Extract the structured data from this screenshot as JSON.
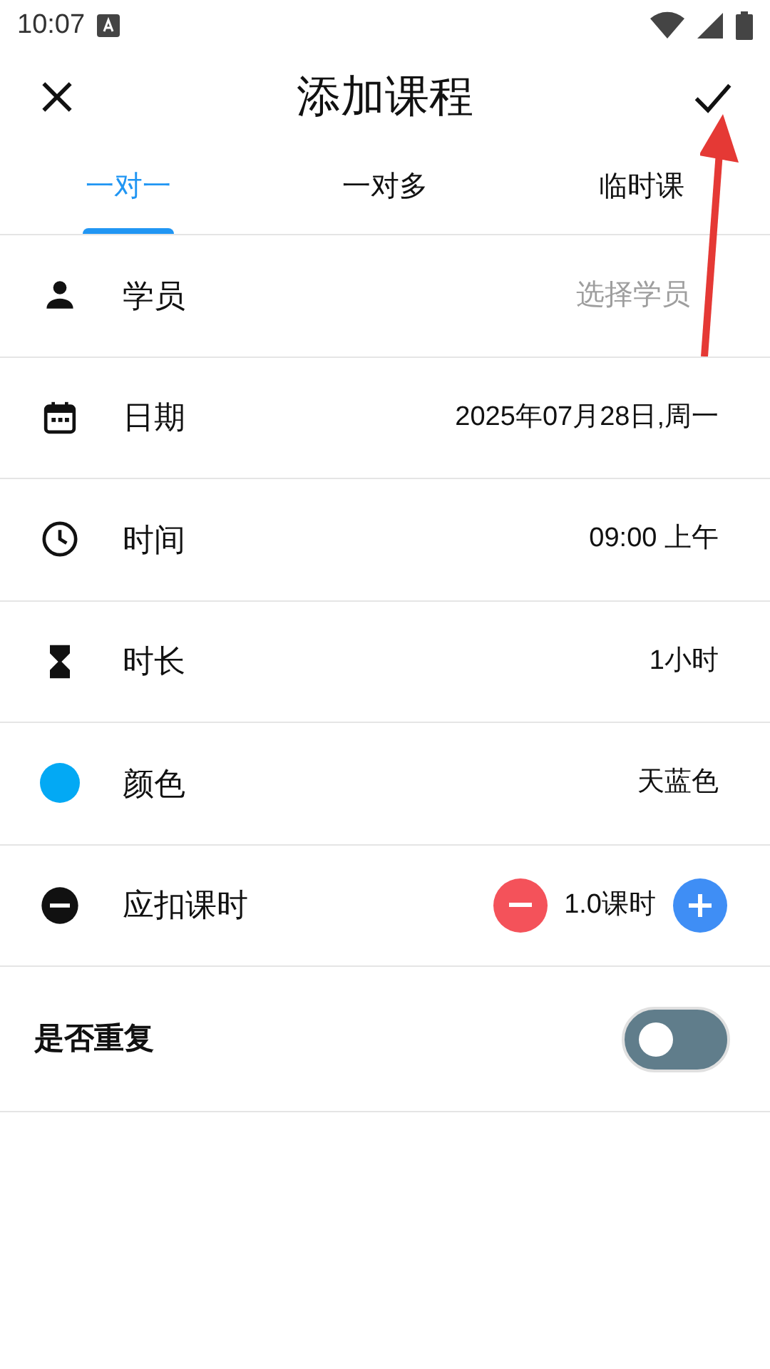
{
  "status_bar": {
    "time": "10:07"
  },
  "header": {
    "title": "添加课程"
  },
  "tabs": [
    {
      "label": "一对一",
      "selected": true
    },
    {
      "label": "一对多",
      "selected": false
    },
    {
      "label": "临时课",
      "selected": false
    }
  ],
  "rows": [
    {
      "kind": "field",
      "label": "学员",
      "placeholder": "选择学员"
    },
    {
      "kind": "field",
      "label": "日期",
      "value": "2025年07月28日,周一"
    },
    {
      "kind": "field",
      "label": "时间",
      "value": "09:00 上午"
    },
    {
      "kind": "field",
      "label": "时长",
      "value": "1小时"
    },
    {
      "kind": "color",
      "label": "颜色",
      "value": "天蓝色",
      "color": "#03a9f4"
    },
    {
      "kind": "stepper",
      "label": "应扣课时",
      "value": "1.0课时"
    }
  ],
  "repeat": {
    "label": "是否重复",
    "on": false
  }
}
